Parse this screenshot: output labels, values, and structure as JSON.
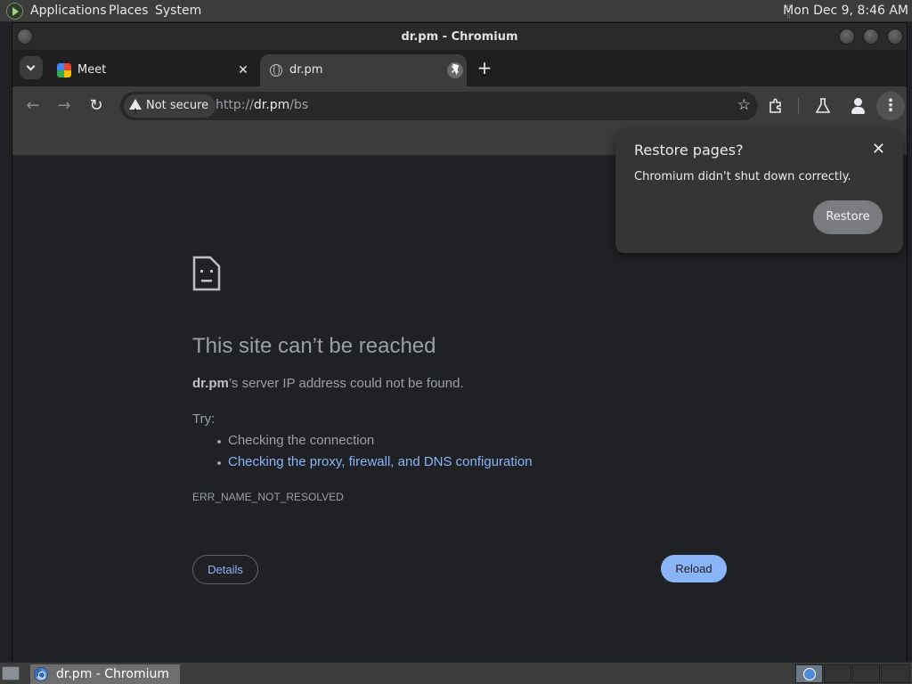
{
  "top_panel": {
    "menus": [
      "Applications",
      "Places",
      "System"
    ],
    "clock": "Mon Dec  9,  8:46 AM"
  },
  "window": {
    "title": "dr.pm - Chromium"
  },
  "tabs": [
    {
      "label": "Meet",
      "icon": "google-meet-icon",
      "active": false
    },
    {
      "label": "dr.pm",
      "icon": "globe-icon",
      "active": true
    }
  ],
  "toolbar": {
    "security_label": "Not secure",
    "url_scheme": "http://",
    "url_host": "dr.pm",
    "url_path": "/bs"
  },
  "restore_popup": {
    "title": "Restore pages?",
    "message": "Chromium didn't shut down correctly.",
    "button": "Restore"
  },
  "error_page": {
    "title": "This site can’t be reached",
    "host": "dr.pm",
    "message_rest": "’s server IP address could not be found.",
    "try_label": "Try:",
    "suggestions": [
      "Checking the connection",
      "Checking the proxy, firewall, and DNS configuration"
    ],
    "error_code": "ERR_NAME_NOT_RESOLVED",
    "details_button": "Details",
    "reload_button": "Reload"
  },
  "taskbar": {
    "window_label": "dr.pm - Chromium"
  },
  "colors": {
    "link": "#8ab4f8",
    "reload_button_bg": "#8ab4f8",
    "page_bg": "#202124"
  }
}
